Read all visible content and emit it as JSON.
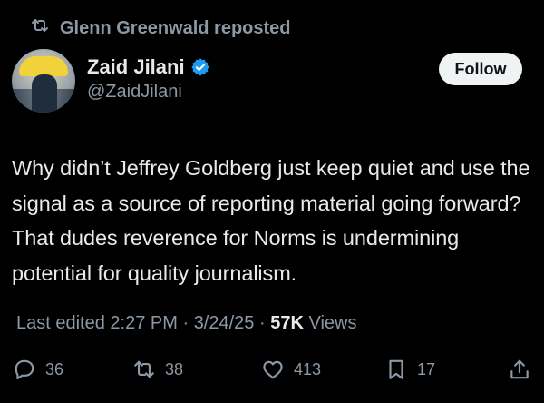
{
  "repost": {
    "text": "Glenn Greenwald reposted",
    "icon": "repost-icon"
  },
  "author": {
    "name": "Zaid Jilani",
    "handle": "@ZaidJilani",
    "verified": true,
    "verified_color": "#1d9bf0"
  },
  "follow_button": {
    "label": "Follow"
  },
  "tweet": {
    "text": "Why didn’t Jeffrey Goldberg just keep quiet and use the signal as a source of reporting material going forward? That dudes reverence for Norms is undermining potential for quality journalism."
  },
  "meta": {
    "edited_label": "Last edited",
    "time": "2:27 PM",
    "separator": " · ",
    "date": "3/24/25",
    "separator2": " · ",
    "views_count": "57K",
    "views_label": " Views"
  },
  "actions": {
    "replies": {
      "icon": "reply-icon",
      "count": "36"
    },
    "reposts": {
      "icon": "repost-icon",
      "count": "38"
    },
    "likes": {
      "icon": "heart-icon",
      "count": "413"
    },
    "bookmarks": {
      "icon": "bookmark-icon",
      "count": "17"
    },
    "share": {
      "icon": "share-icon"
    }
  }
}
